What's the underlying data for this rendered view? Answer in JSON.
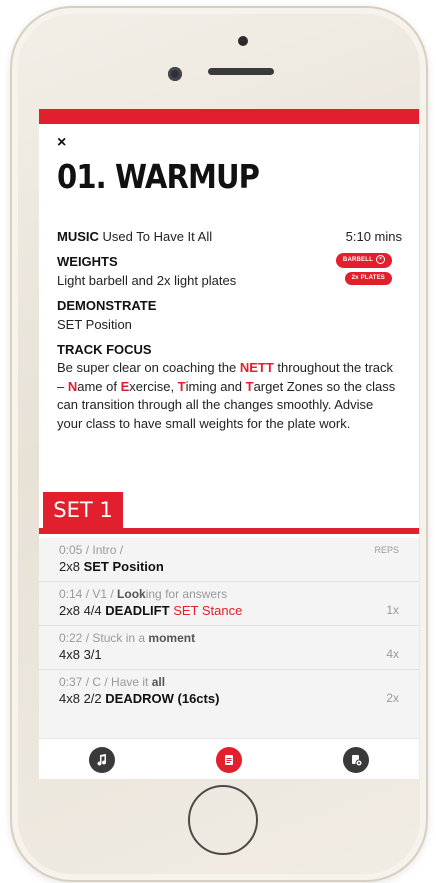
{
  "screen": {
    "close_icon": "×",
    "title": "01. WARMUP",
    "music": {
      "label": "MUSIC",
      "song": "Used To Have It All",
      "duration": "5:10 mins"
    },
    "weights": {
      "label": "WEIGHTS",
      "text": "Light barbell and 2x light plates",
      "badges": [
        "BARBELL",
        "2x PLATES"
      ]
    },
    "demonstrate": {
      "label": "DEMONSTRATE",
      "text": "SET Position"
    },
    "track_focus": {
      "label": "TRACK FOCUS",
      "part1": "Be super clear on coaching the ",
      "nett": "NETT",
      "part2": " throughout the track – ",
      "n": "N",
      "part3": "ame of ",
      "e": "E",
      "part4": "xercise, ",
      "t1": "T",
      "part5": "iming and ",
      "t2": "T",
      "part6": "arget Zones so the class can transition through all the changes smoothly. Advise your class to have small weights for the plate work."
    },
    "set_title": "SET 1",
    "reps_header": "REPS",
    "tracks": [
      {
        "time": "0:05 / Intro /",
        "lyric_bold": "",
        "count": "2x8",
        "move": "SET Position",
        "extra": "",
        "reps": ""
      },
      {
        "time": "0:14 / V1 /",
        "lyric_pre": "Look",
        "lyric_bold": "ing for answers",
        "count": "2x8 4/4",
        "move": "DEADLIFT",
        "extra": "SET Stance",
        "reps": "1x"
      },
      {
        "time": "0:22 / Stuck in a",
        "lyric_bold": "moment",
        "count": "4x8 3/1",
        "move": "",
        "extra": "",
        "reps": "4x"
      },
      {
        "time": "0:37 / C / Have it",
        "lyric_bold": "all",
        "count": "4x8 2/2",
        "move": "DEADROW",
        "extra": "(16cts)",
        "reps": "2x"
      }
    ]
  },
  "nav": {
    "items": [
      "music-icon",
      "workout-icon",
      "settings-icon"
    ],
    "active": "workout-icon"
  },
  "colors": {
    "accent": "#e21f2c",
    "icon_dark": "#3a3a3a"
  }
}
